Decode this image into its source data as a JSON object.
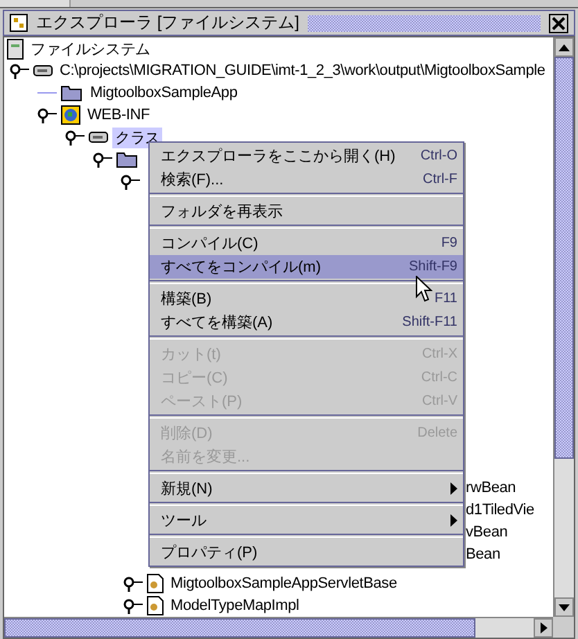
{
  "window": {
    "title": "エクスプローラ [ファイルシステム]"
  },
  "tree": {
    "label": "ファイルシステム",
    "children": [
      {
        "label": "C:\\projects\\MIGRATION_GUIDE\\imt-1_2_3\\work\\output\\MigtoolboxSample",
        "expanded": true,
        "children": [
          {
            "label": "MigtoolboxSampleApp"
          },
          {
            "label": "WEB-INF",
            "expanded": true,
            "children": [
              {
                "label": "クラス",
                "expanded": true,
                "selected": true
              }
            ]
          }
        ]
      }
    ]
  },
  "covered_rows": [
    {
      "label": "rwBean"
    },
    {
      "label": "d1TiledVie"
    },
    {
      "label": "vBean"
    },
    {
      "label": "Bean"
    }
  ],
  "lower_rows": [
    {
      "label": "MigtoolboxSampleAppServletBase"
    },
    {
      "label": "ModelTypeMapImpl"
    }
  ],
  "context_menu": [
    {
      "kind": "item",
      "label": "エクスプローラをここから開く(H)",
      "shortcut": "Ctrl-O",
      "disabled": false,
      "selected": false
    },
    {
      "kind": "item",
      "label": "検索(F)...",
      "shortcut": "Ctrl-F",
      "disabled": false,
      "selected": false
    },
    {
      "kind": "separator"
    },
    {
      "kind": "item",
      "label": "フォルダを再表示",
      "disabled": false,
      "selected": false
    },
    {
      "kind": "separator"
    },
    {
      "kind": "item",
      "label": "コンパイル(C)",
      "shortcut": "F9",
      "disabled": false,
      "selected": false
    },
    {
      "kind": "item",
      "label": "すべてをコンパイル(m)",
      "shortcut": "Shift-F9",
      "disabled": false,
      "selected": true
    },
    {
      "kind": "separator"
    },
    {
      "kind": "item",
      "label": "構築(B)",
      "shortcut": "F11",
      "disabled": false,
      "selected": false
    },
    {
      "kind": "item",
      "label": "すべてを構築(A)",
      "shortcut": "Shift-F11",
      "disabled": false,
      "selected": false
    },
    {
      "kind": "separator"
    },
    {
      "kind": "item",
      "label": "カット(t)",
      "shortcut": "Ctrl-X",
      "disabled": true,
      "selected": false
    },
    {
      "kind": "item",
      "label": "コピー(C)",
      "shortcut": "Ctrl-C",
      "disabled": true,
      "selected": false
    },
    {
      "kind": "item",
      "label": "ペースト(P)",
      "shortcut": "Ctrl-V",
      "disabled": true,
      "selected": false
    },
    {
      "kind": "separator"
    },
    {
      "kind": "item",
      "label": "削除(D)",
      "shortcut": "Delete",
      "disabled": true,
      "selected": false
    },
    {
      "kind": "item",
      "label": "名前を変更...",
      "disabled": true,
      "selected": false
    },
    {
      "kind": "separator"
    },
    {
      "kind": "submenu",
      "label": "新規(N)",
      "disabled": false,
      "selected": false
    },
    {
      "kind": "separator"
    },
    {
      "kind": "submenu",
      "label": "ツール",
      "disabled": false,
      "selected": false
    },
    {
      "kind": "separator"
    },
    {
      "kind": "item",
      "label": "プロパティ(P)",
      "disabled": false,
      "selected": false
    }
  ]
}
